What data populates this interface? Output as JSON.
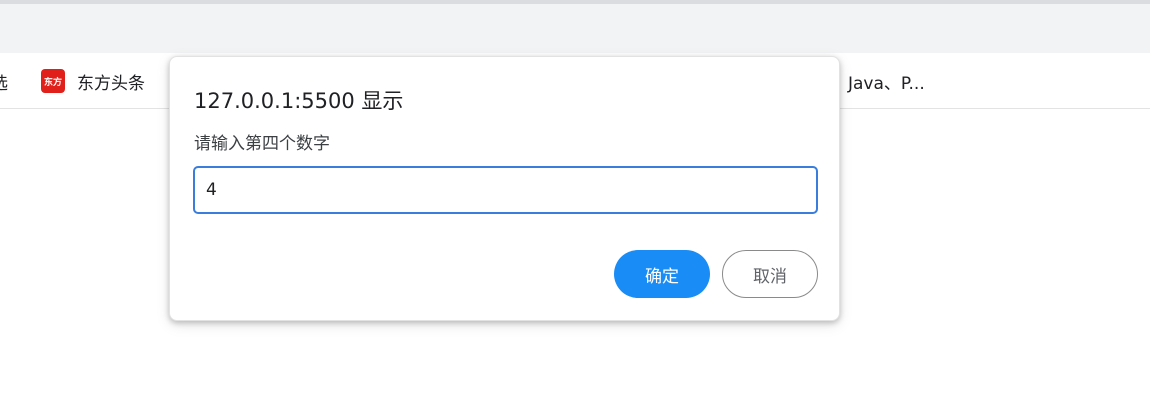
{
  "bookmarks": {
    "items": [
      {
        "label": "选"
      },
      {
        "label": "东方头条",
        "icon_text": "东方",
        "icon_color": "#e0201b"
      },
      {
        "label": "Java、P..."
      }
    ]
  },
  "dialog": {
    "title": "127.0.0.1:5500 显示",
    "message": "请输入第四个数字",
    "input_value": "4",
    "ok_label": "确定",
    "cancel_label": "取消"
  },
  "colors": {
    "accent": "#1a8cf5",
    "input_focus_border": "#3b7ddd",
    "toolbar_bg": "#f1f3f4"
  }
}
